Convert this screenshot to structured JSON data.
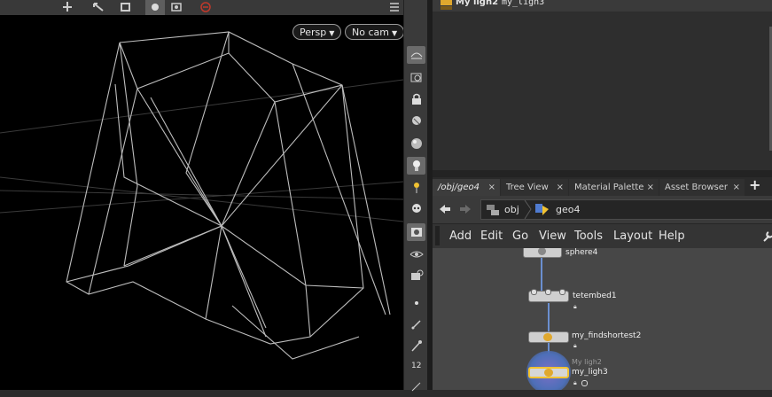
{
  "viewport": {
    "camera_menu": "Persp",
    "cam_menu": "No cam"
  },
  "parameters": {
    "node_type_label": "My ligh2",
    "node_name": "my_ligh3"
  },
  "tabs": [
    {
      "label": "/obj/geo4",
      "active": true
    },
    {
      "label": "Tree View",
      "active": false
    },
    {
      "label": "Material Palette",
      "active": false
    },
    {
      "label": "Asset Browser",
      "active": false
    }
  ],
  "tab_close": "×",
  "add_tab": "+",
  "path": {
    "root": "obj",
    "current": "geo4"
  },
  "menu": [
    "Add",
    "Edit",
    "Go",
    "View",
    "Tools",
    "Layout",
    "Help"
  ],
  "nodes": [
    {
      "name": "sphere4"
    },
    {
      "name": "tetembed1"
    },
    {
      "name": "my_findshortest2"
    },
    {
      "type_label": "My ligh2",
      "name": "my_ligh3",
      "selected": true
    }
  ],
  "shelf_label_12": "12",
  "colors": {
    "wire": "#6b8fd0",
    "selected_node": "#f1c232",
    "selected_glow": "#4d6fb8"
  }
}
